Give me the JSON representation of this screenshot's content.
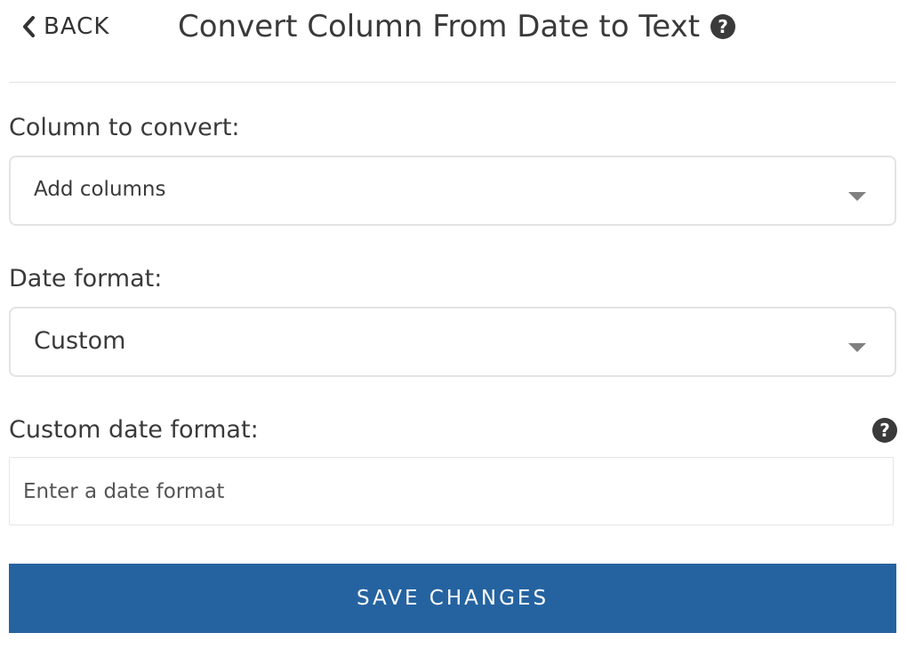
{
  "header": {
    "back_label": "BACK",
    "title": "Convert Column From Date to Text",
    "help_icon_glyph": "?"
  },
  "column_field": {
    "label": "Column to convert:",
    "selected_value": "Add columns"
  },
  "date_format_field": {
    "label": "Date format:",
    "selected_value": "Custom"
  },
  "custom_format_field": {
    "label": "Custom date format:",
    "value": "",
    "placeholder": "Enter a date format",
    "help_icon_glyph": "?"
  },
  "save_button": {
    "label": "SAVE CHANGES"
  },
  "colors": {
    "primary": "#2563a0",
    "text": "#3a3a3a",
    "border": "#e3e3e3",
    "caret": "#808080"
  },
  "icons": {
    "back": "chevron-left-icon",
    "help": "question-circle-icon",
    "dropdown": "caret-down-icon"
  }
}
